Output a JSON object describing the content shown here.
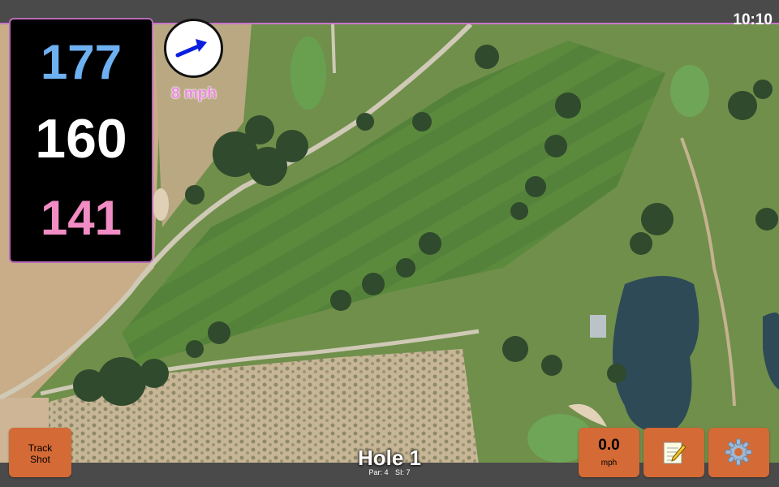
{
  "clock": "10:10",
  "distances": {
    "back": "177",
    "center": "160",
    "front": "141"
  },
  "wind": {
    "speed_label": "8 mph",
    "direction_icon": "arrow-icon"
  },
  "hole": {
    "title": "Hole 1",
    "par_label": "Par: 4",
    "si_label": "SI: 7"
  },
  "buttons": {
    "track_shot": {
      "line1": "Track",
      "line2": "Shot"
    },
    "speed": {
      "value": "0.0",
      "unit": "mph"
    },
    "notes": {
      "icon": "notepad-icon"
    },
    "settings": {
      "icon": "gear-icon"
    }
  },
  "colors": {
    "accent": "#d46a35",
    "back": "#6eb1f2",
    "center": "#ffffff",
    "front": "#f28cc4",
    "wind": "#e98bdf",
    "frame": "#b86bb8"
  }
}
